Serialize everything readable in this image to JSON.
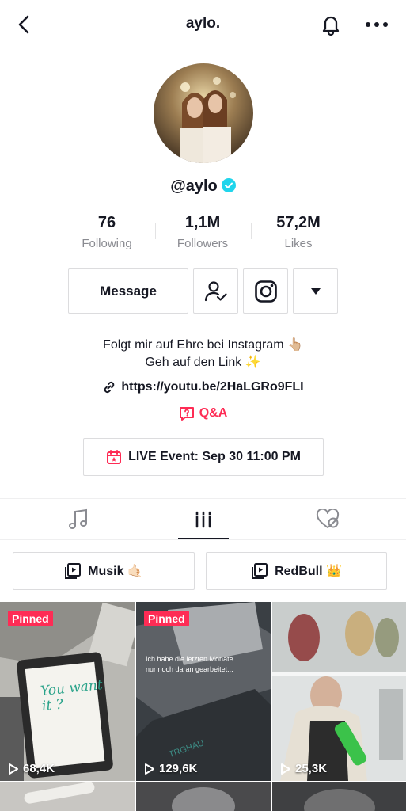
{
  "header": {
    "title": "aylo."
  },
  "profile": {
    "handle": "@aylo"
  },
  "stats": [
    {
      "value": "76",
      "label": "Following"
    },
    {
      "value": "1,1M",
      "label": "Followers"
    },
    {
      "value": "57,2M",
      "label": "Likes"
    }
  ],
  "actions": {
    "message_label": "Message"
  },
  "bio": {
    "line1": "Folgt mir auf Ehre bei Instagram 👆🏼",
    "line2": "Geh auf den Link ✨"
  },
  "link": {
    "url": "https://youtu.be/2HaLGRo9FLI"
  },
  "qa": {
    "label": "Q&A"
  },
  "event": {
    "label": "LIVE Event: Sep 30 11:00 PM"
  },
  "playlists": [
    {
      "label": "Musik 🤙🏻"
    },
    {
      "label": "RedBull 👑"
    }
  ],
  "videos": [
    {
      "pinned": "Pinned",
      "views": "68,4K",
      "overlay": "You want it ?"
    },
    {
      "pinned": "Pinned",
      "views": "129,6K",
      "overlay": "Ich habe die letzten Monate nur noch daran gearbeitet..."
    },
    {
      "views": "25,3K"
    }
  ],
  "colors": {
    "accent": "#fe2c55",
    "verified": "#20d5ec",
    "text": "#161823",
    "muted": "#8a8b91"
  },
  "icons": [
    "back-icon",
    "bell-icon",
    "more-icon",
    "verified-icon",
    "follow-user-icon",
    "instagram-icon",
    "chevron-down-icon",
    "link-icon",
    "qa-icon",
    "calendar-icon",
    "music-icon",
    "grid-icon",
    "liked-hidden-icon",
    "playlist-icon",
    "play-icon"
  ]
}
